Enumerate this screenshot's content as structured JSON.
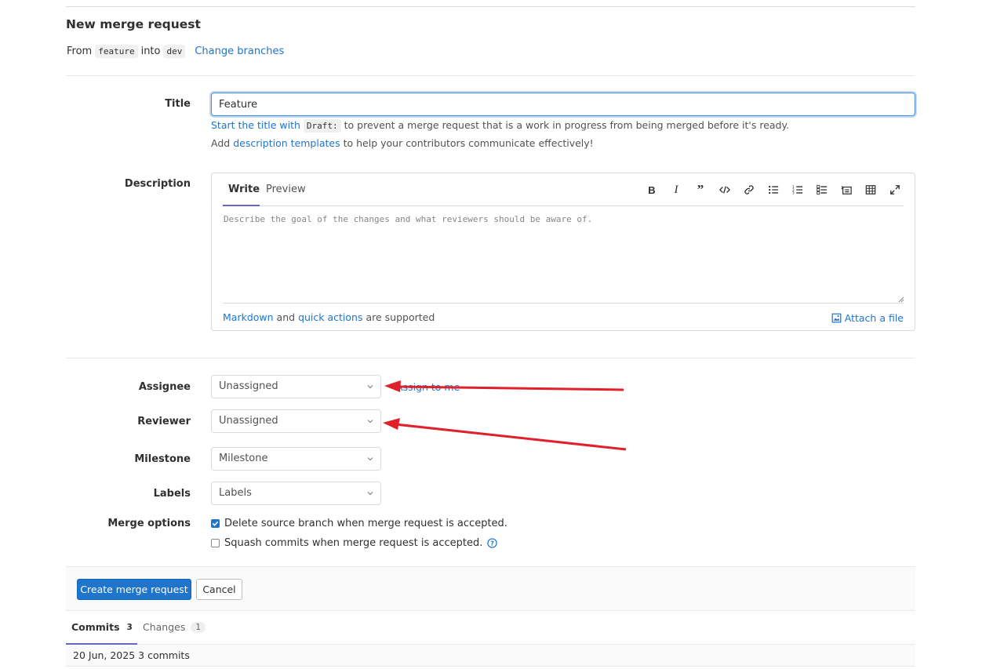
{
  "header": {
    "title": "New merge request",
    "from_text": "From",
    "source_branch": "feature",
    "into_text": "into",
    "target_branch": "dev",
    "change_branches": "Change branches"
  },
  "form": {
    "title_label": "Title",
    "title_value": "Feature",
    "draft_hint_link": "Start the title with",
    "draft_code": "Draft:",
    "draft_hint_rest": "to prevent a merge request that is a work in progress from being merged before it's ready.",
    "template_hint_add": "Add",
    "template_hint_link": "description templates",
    "template_hint_rest": "to help your contributors communicate effectively!",
    "description_label": "Description",
    "tabs": [
      "Write",
      "Preview"
    ],
    "description_placeholder": "Describe the goal of the changes and what reviewers should be aware of.",
    "markdown_link": "Markdown",
    "and_text": "and",
    "quick_actions_link": "quick actions",
    "supported_text": "are supported",
    "attach_file": "Attach a file",
    "toolbar_icons": [
      "bold-icon",
      "italic-icon",
      "quote-icon",
      "code-icon",
      "link-icon",
      "bulleted-list-icon",
      "numbered-list-icon",
      "task-list-icon",
      "collapsible-section-icon",
      "table-icon",
      "fullscreen-icon"
    ]
  },
  "sidebar_fields": {
    "assignee_label": "Assignee",
    "assignee_value": "Unassigned",
    "assign_to_me": "Assign to me",
    "reviewer_label": "Reviewer",
    "reviewer_value": "Unassigned",
    "milestone_label": "Milestone",
    "milestone_value": "Milestone",
    "labels_label": "Labels",
    "labels_value": "Labels",
    "merge_options_label": "Merge options",
    "delete_source_branch": "Delete source branch when merge request is accepted.",
    "delete_source_branch_checked": true,
    "squash_commits": "Squash commits when merge request is accepted.",
    "squash_commits_checked": false
  },
  "actions": {
    "create": "Create merge request",
    "cancel": "Cancel"
  },
  "bottom_tabs": {
    "commits_label": "Commits",
    "commits_count": "3",
    "changes_label": "Changes",
    "changes_count": "1"
  },
  "commits": {
    "row_text": "20 Jun, 2025 3 commits"
  },
  "colors": {
    "link": "#1f75cb",
    "primary_button": "#1f75cb",
    "tab_underline": "#6666c4",
    "annotation_arrow": "#e0202a"
  }
}
